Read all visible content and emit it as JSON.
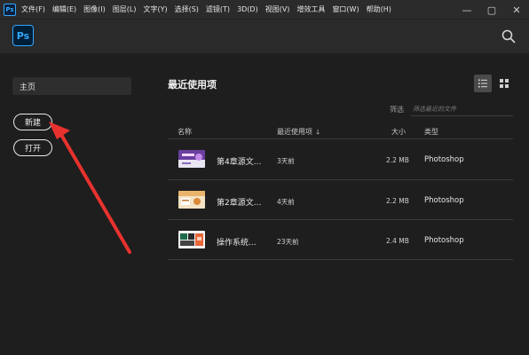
{
  "menubar": {
    "app_icon_text": "Ps",
    "items": [
      "文件(F)",
      "编辑(E)",
      "图像(I)",
      "图层(L)",
      "文字(Y)",
      "选择(S)",
      "滤镜(T)",
      "3D(D)",
      "视图(V)",
      "增效工具",
      "窗口(W)",
      "帮助(H)"
    ],
    "window_controls": [
      "—",
      "▢",
      "✕"
    ]
  },
  "header": {
    "logo_text": "Ps",
    "search_icon": "search-icon"
  },
  "sidebar": {
    "home_label": "主页",
    "new_label": "新建",
    "open_label": "打开"
  },
  "main": {
    "title": "最近使用项",
    "filter_label": "筛选",
    "filter_placeholder": "筛选最近的文件",
    "columns": {
      "name": "名称",
      "recent": "最近使用项",
      "size": "大小",
      "type": "类型"
    },
    "rows": [
      {
        "name": "第4章源文...",
        "used": "3天前",
        "size": "2.2 MB",
        "type": "Photoshop"
      },
      {
        "name": "第2章源文...",
        "used": "4天前",
        "size": "2.2 MB",
        "type": "Photoshop"
      },
      {
        "name": "操作系统...",
        "used": "23天前",
        "size": "2.4 MB",
        "type": "Photoshop"
      }
    ]
  },
  "colors": {
    "accent": "#31a8ff",
    "annotation_arrow": "#e8322f",
    "background": "#1e1e1e"
  }
}
